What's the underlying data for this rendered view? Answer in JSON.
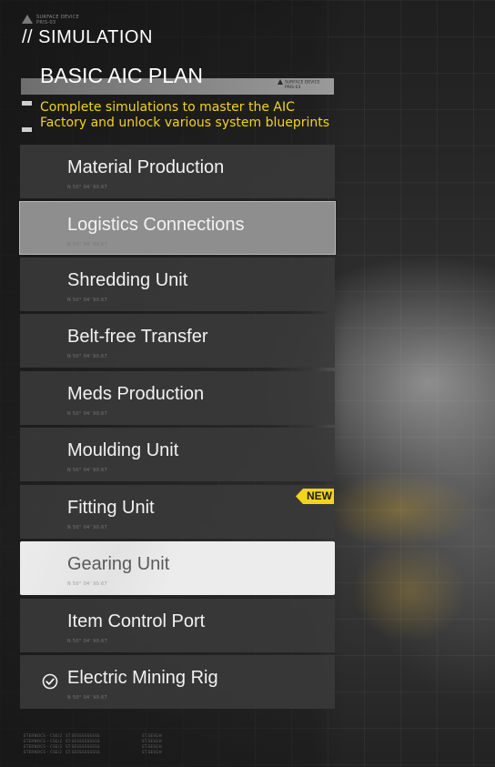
{
  "brand": {
    "line1": "SURFACE DEVICE",
    "line2": "PRIS-03"
  },
  "title": "// SIMULATION",
  "plan": {
    "title": "BASIC AIC PLAN",
    "tag_line1": "SURFACE DEVICE",
    "tag_line2": "PRIS-03",
    "description": "Complete simulations to master the AIC Factory and unlock various system blueprints"
  },
  "items": [
    {
      "label": "Material Production",
      "sub": "N 50° 04' 90.67",
      "state": "normal"
    },
    {
      "label": "Logistics Connections",
      "sub": "N 50° 04' 90.67",
      "state": "hover"
    },
    {
      "label": "Shredding Unit",
      "sub": "N 50° 04' 90.67",
      "state": "normal"
    },
    {
      "label": "Belt-free Transfer",
      "sub": "N 50° 04' 90.67",
      "state": "normal"
    },
    {
      "label": "Meds Production",
      "sub": "N 50° 04' 90.67",
      "state": "normal"
    },
    {
      "label": "Moulding Unit",
      "sub": "N 50° 04' 90.67",
      "state": "normal"
    },
    {
      "label": "Fitting Unit",
      "sub": "N 50° 04' 90.67",
      "state": "normal",
      "badge": "NEW"
    },
    {
      "label": "Gearing Unit",
      "sub": "N 50° 04' 90.67",
      "state": "selected"
    },
    {
      "label": "Item Control Port",
      "sub": "N 50° 04' 90.67",
      "state": "normal"
    },
    {
      "label": "Electric Mining Rig",
      "sub": "N 50° 04' 90.67",
      "state": "completed",
      "icon": "checkmark-circle-icon"
    }
  ],
  "footer": {
    "col1": [
      "ETERNOCS - CSE/2",
      "ETERNOCS - CSE/2",
      "ETERNOCS - CSE/2",
      "ETERNOCS - CSE/2"
    ],
    "col2": [
      "ST.SESSSSSSSSS",
      "ST.SESSSSSSSSS",
      "ST.SESSSSSSSSS",
      "ST.SESSSSSSSSS"
    ],
    "col3": [
      "ST.SESGH",
      "ST.SESGH",
      "ST.SESGH",
      "ST.SESGH"
    ]
  },
  "colors": {
    "accent_yellow": "#f2d41c",
    "selected_bg": "#ececec",
    "hover_bg": "#8e8e8e"
  }
}
